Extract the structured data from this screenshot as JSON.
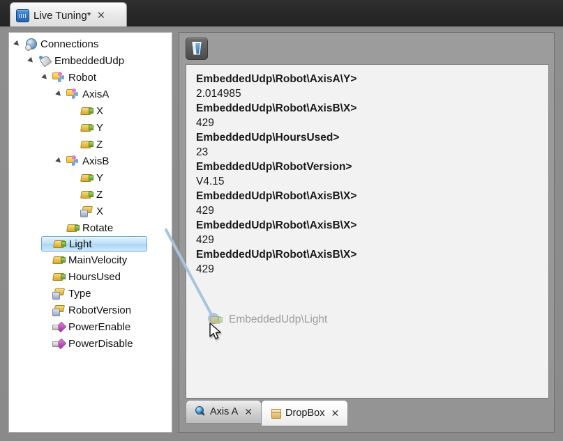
{
  "window": {
    "tab": {
      "label": "Live Tuning*",
      "close": "✕",
      "icon": "live-tuning-icon"
    }
  },
  "tree": {
    "nodes": [
      {
        "label": "Connections",
        "depth": 0,
        "icon": "globe-icon",
        "expander": "open",
        "selected": false
      },
      {
        "label": "EmbeddedUdp",
        "depth": 1,
        "icon": "connection-icon",
        "expander": "open",
        "selected": false
      },
      {
        "label": "Robot",
        "depth": 2,
        "icon": "group-icon",
        "expander": "open",
        "selected": false
      },
      {
        "label": "AxisA",
        "depth": 3,
        "icon": "group-icon",
        "expander": "open",
        "selected": false
      },
      {
        "label": "X",
        "depth": 4,
        "icon": "variable-icon",
        "expander": "none",
        "selected": false
      },
      {
        "label": "Y",
        "depth": 4,
        "icon": "variable-icon",
        "expander": "none",
        "selected": false
      },
      {
        "label": "Z",
        "depth": 4,
        "icon": "variable-icon",
        "expander": "none",
        "selected": false
      },
      {
        "label": "AxisB",
        "depth": 3,
        "icon": "group-icon",
        "expander": "open",
        "selected": false
      },
      {
        "label": "Y",
        "depth": 4,
        "icon": "variable-icon",
        "expander": "none",
        "selected": false
      },
      {
        "label": "Z",
        "depth": 4,
        "icon": "variable-icon",
        "expander": "none",
        "selected": false
      },
      {
        "label": "X",
        "depth": 4,
        "icon": "variable-locked-icon",
        "expander": "none",
        "selected": false
      },
      {
        "label": "Rotate",
        "depth": 3,
        "icon": "variable-icon",
        "expander": "none",
        "selected": false
      },
      {
        "label": "Light",
        "depth": 2,
        "icon": "variable-icon",
        "expander": "none",
        "selected": true
      },
      {
        "label": "MainVelocity",
        "depth": 2,
        "icon": "variable-icon",
        "expander": "none",
        "selected": false
      },
      {
        "label": "HoursUsed",
        "depth": 2,
        "icon": "variable-icon",
        "expander": "none",
        "selected": false
      },
      {
        "label": "Type",
        "depth": 2,
        "icon": "variable-locked-icon",
        "expander": "none",
        "selected": false
      },
      {
        "label": "RobotVersion",
        "depth": 2,
        "icon": "variable-locked-icon",
        "expander": "none",
        "selected": false
      },
      {
        "label": "PowerEnable",
        "depth": 2,
        "icon": "command-icon",
        "expander": "none",
        "selected": false
      },
      {
        "label": "PowerDisable",
        "depth": 2,
        "icon": "command-icon",
        "expander": "none",
        "selected": false
      }
    ]
  },
  "toolbar": {
    "clear_button_label": "",
    "clear_button_icon": "clear-icon"
  },
  "drop_panel": {
    "entries": [
      {
        "path": "EmbeddedUdp\\Robot\\AxisA\\Y>",
        "value": "2.014985"
      },
      {
        "path": "EmbeddedUdp\\Robot\\AxisB\\X>",
        "value": "429"
      },
      {
        "path": "EmbeddedUdp\\HoursUsed>",
        "value": "23"
      },
      {
        "path": "EmbeddedUdp\\RobotVersion>",
        "value": "V4.15"
      },
      {
        "path": "EmbeddedUdp\\Robot\\AxisB\\X>",
        "value": "429"
      },
      {
        "path": "EmbeddedUdp\\Robot\\AxisB\\X>",
        "value": "429"
      },
      {
        "path": "EmbeddedUdp\\Robot\\AxisB\\X>",
        "value": "429"
      }
    ],
    "drag_ghost_label": "EmbeddedUdp\\Light"
  },
  "bottom_tabs": [
    {
      "label": "Axis A",
      "icon": "search-icon",
      "close": "✕",
      "active": false
    },
    {
      "label": "DropBox",
      "icon": "box-icon",
      "close": "✕",
      "active": true
    }
  ],
  "colors": {
    "selection_blue": "#a9d4f3",
    "drag_line": "#a9c4de",
    "panel_bg": "#f2f2f2",
    "chrome_gray": "#8e8e8e",
    "titlebar_dark": "#262626"
  }
}
